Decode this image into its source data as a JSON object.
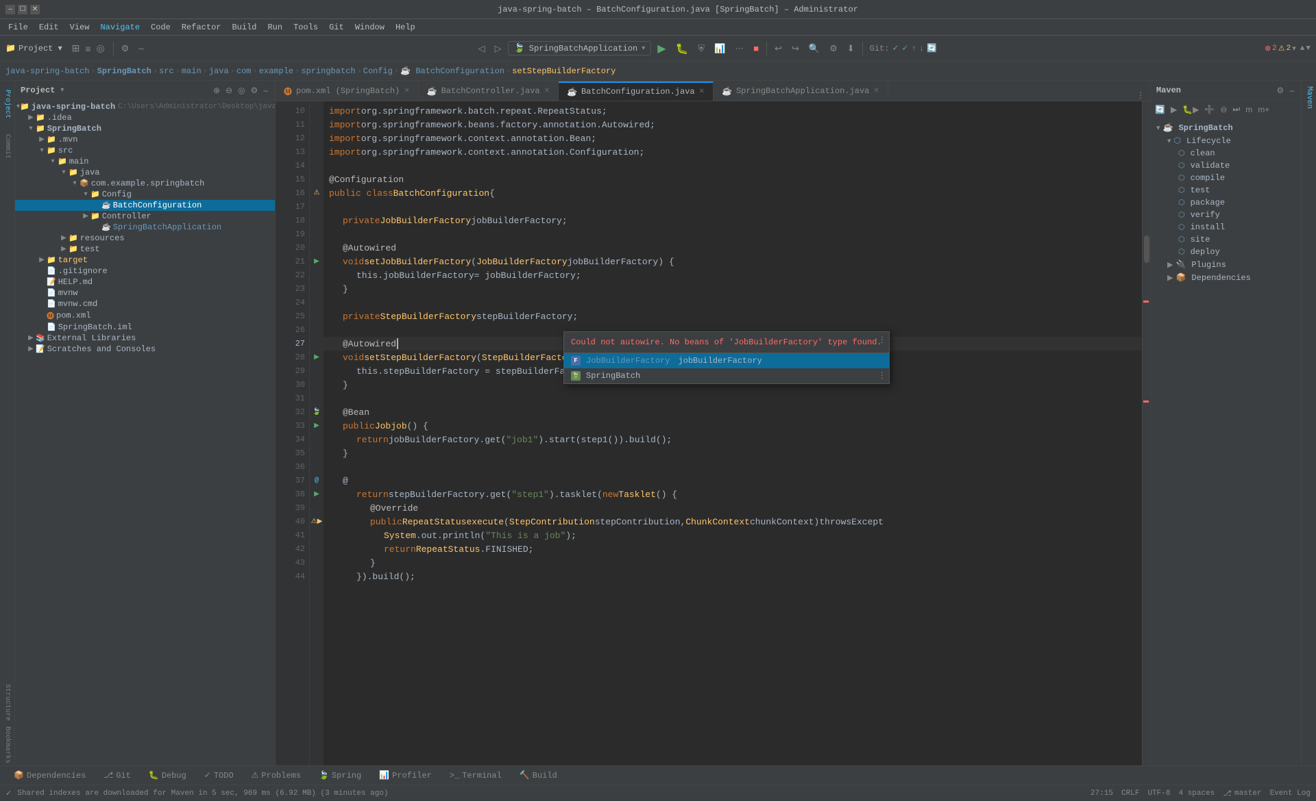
{
  "titleBar": {
    "title": "java-spring-batch – BatchConfiguration.java [SpringBatch] – Administrator",
    "minimize": "–",
    "maximize": "☐",
    "close": "✕"
  },
  "menuBar": {
    "items": [
      "File",
      "Edit",
      "View",
      "Navigate",
      "Code",
      "Refactor",
      "Build",
      "Run",
      "Tools",
      "Git",
      "Window",
      "Help"
    ]
  },
  "navBar": {
    "breadcrumbs": [
      "java-spring-batch",
      "SpringBatch",
      "src",
      "main",
      "java",
      "com",
      "example",
      "springbatch",
      "Config",
      "BatchConfiguration",
      "setStepBuilderFactory"
    ]
  },
  "toolbar": {
    "projectLabel": "Project",
    "runConfig": "SpringBatchApplication",
    "gitBranch": "Git:",
    "masterBranch": "master"
  },
  "tabs": {
    "items": [
      {
        "name": "pom.xml",
        "module": "SpringBatch",
        "active": false,
        "icon": "📄"
      },
      {
        "name": "BatchController.java",
        "active": false,
        "icon": "☕"
      },
      {
        "name": "BatchConfiguration.java",
        "active": true,
        "icon": "☕"
      },
      {
        "name": "SpringBatchApplication.java",
        "active": false,
        "icon": "☕"
      }
    ]
  },
  "fileTree": {
    "rootLabel": "java-spring-batch",
    "rootPath": "C:\\Users\\Administrator\\Desktop\\java-spring",
    "items": [
      {
        "label": "idea",
        "indent": 1,
        "type": "folder",
        "expanded": false
      },
      {
        "label": "SpringBatch",
        "indent": 1,
        "type": "folder",
        "expanded": true,
        "bold": true
      },
      {
        "label": ".mvn",
        "indent": 2,
        "type": "folder",
        "expanded": false
      },
      {
        "label": "src",
        "indent": 2,
        "type": "folder",
        "expanded": true
      },
      {
        "label": "main",
        "indent": 3,
        "type": "folder",
        "expanded": true
      },
      {
        "label": "java",
        "indent": 4,
        "type": "folder",
        "expanded": true
      },
      {
        "label": "com.example.springbatch",
        "indent": 5,
        "type": "package",
        "expanded": true
      },
      {
        "label": "Config",
        "indent": 6,
        "type": "folder",
        "expanded": true
      },
      {
        "label": "BatchConfiguration",
        "indent": 7,
        "type": "java",
        "selected": true
      },
      {
        "label": "Controller",
        "indent": 6,
        "type": "folder",
        "expanded": true
      },
      {
        "label": "SpringBatchApplication",
        "indent": 7,
        "type": "java-spring"
      },
      {
        "label": "resources",
        "indent": 4,
        "type": "folder",
        "expanded": false
      },
      {
        "label": "test",
        "indent": 4,
        "type": "folder",
        "expanded": false
      },
      {
        "label": "target",
        "indent": 2,
        "type": "folder",
        "expanded": false,
        "color": "orange"
      },
      {
        "label": ".gitignore",
        "indent": 2,
        "type": "file"
      },
      {
        "label": "HELP.md",
        "indent": 2,
        "type": "md"
      },
      {
        "label": "mvnw",
        "indent": 2,
        "type": "file"
      },
      {
        "label": "mvnw.cmd",
        "indent": 2,
        "type": "file"
      },
      {
        "label": "pom.xml",
        "indent": 2,
        "type": "xml"
      },
      {
        "label": "SpringBatch.iml",
        "indent": 2,
        "type": "iml"
      },
      {
        "label": "External Libraries",
        "indent": 1,
        "type": "libs",
        "expanded": false
      },
      {
        "label": "Scratches and Consoles",
        "indent": 1,
        "type": "scratches",
        "expanded": false
      }
    ]
  },
  "codeLines": [
    {
      "num": 10,
      "content": "import org.springframework.batch.repeat.RepeatStatus;",
      "gutter": ""
    },
    {
      "num": 11,
      "content": "import org.springframework.beans.factory.annotation.Autowired;",
      "gutter": ""
    },
    {
      "num": 12,
      "content": "import org.springframework.context.annotation.Bean;",
      "gutter": ""
    },
    {
      "num": 13,
      "content": "import org.springframework.context.annotation.Configuration;",
      "gutter": ""
    },
    {
      "num": 14,
      "content": "",
      "gutter": ""
    },
    {
      "num": 15,
      "content": "@Configuration",
      "gutter": ""
    },
    {
      "num": 16,
      "content": "public class BatchConfiguration {",
      "gutter": "warning"
    },
    {
      "num": 17,
      "content": "",
      "gutter": ""
    },
    {
      "num": 18,
      "content": "    private JobBuilderFactory jobBuilderFactory;",
      "gutter": ""
    },
    {
      "num": 19,
      "content": "",
      "gutter": ""
    },
    {
      "num": 20,
      "content": "    @Autowired",
      "gutter": ""
    },
    {
      "num": 21,
      "content": "    void setJobBuilderFactory (JobBuilderFactory jobBuilderFactory) {",
      "gutter": "method"
    },
    {
      "num": 22,
      "content": "        this.jobBuilderFactory = jobBuilderFactory;",
      "gutter": ""
    },
    {
      "num": 23,
      "content": "    }",
      "gutter": ""
    },
    {
      "num": 24,
      "content": "",
      "gutter": ""
    },
    {
      "num": 25,
      "content": "    private StepBuilderFactory stepBuilderFactory;",
      "gutter": ""
    },
    {
      "num": 26,
      "content": "",
      "gutter": ""
    },
    {
      "num": 27,
      "content": "    @Autowired",
      "gutter": ""
    },
    {
      "num": 28,
      "content": "    void setStepBuilderFactory (StepBuilderFactory stepBuilderFactory) {",
      "gutter": "method"
    },
    {
      "num": 29,
      "content": "        this.stepBuilderFactory = stepBuilderFactory;",
      "gutter": ""
    },
    {
      "num": 30,
      "content": "    }",
      "gutter": ""
    },
    {
      "num": 31,
      "content": "",
      "gutter": ""
    },
    {
      "num": 32,
      "content": "    @Bean",
      "gutter": "bean"
    },
    {
      "num": 33,
      "content": "    public Job job () {",
      "gutter": "method"
    },
    {
      "num": 34,
      "content": "        return jobBuilderFactory.get(\"job1\").start(step1()).build();",
      "gutter": ""
    },
    {
      "num": 35,
      "content": "    }",
      "gutter": ""
    },
    {
      "num": 36,
      "content": "",
      "gutter": ""
    },
    {
      "num": 37,
      "content": "    @",
      "gutter": "ann"
    },
    {
      "num": 38,
      "content": "        return stepBuilderFactory.get(\"step1\").tasklet(new Tasklet() {",
      "gutter": "method"
    },
    {
      "num": 39,
      "content": "            @Override",
      "gutter": ""
    },
    {
      "num": 40,
      "content": "            public RepeatStatus execute(StepContribution stepContribution, ChunkContext chunkContext) throws Except",
      "gutter": "warning-method"
    },
    {
      "num": 41,
      "content": "                System.out.println(\"This is a job\");",
      "gutter": ""
    },
    {
      "num": 42,
      "content": "                return RepeatStatus.FINISHED;",
      "gutter": ""
    },
    {
      "num": 43,
      "content": "            }",
      "gutter": ""
    },
    {
      "num": 44,
      "content": "        }).build();",
      "gutter": ""
    }
  ],
  "autocomplete": {
    "warning": "Could not autowire. No beans of 'JobBuilderFactory' type found.",
    "item1_type": "JobBuilderFactory",
    "item1_name": "jobBuilderFactory",
    "item2_name": "SpringBatch",
    "moreBtn": "⋮"
  },
  "maven": {
    "title": "Maven",
    "tree": {
      "springBatch": "SpringBatch",
      "lifecycle": "Lifecycle",
      "lifecycleItems": [
        "clean",
        "validate",
        "compile",
        "test",
        "package",
        "verify",
        "install",
        "site",
        "deploy"
      ],
      "plugins": "Plugins",
      "dependencies": "Dependencies"
    }
  },
  "bottomTabs": {
    "items": [
      {
        "label": "Dependencies",
        "icon": "📦",
        "active": false
      },
      {
        "label": "Git",
        "icon": "⎇",
        "active": false
      },
      {
        "label": "Debug",
        "icon": "🐛",
        "active": false
      },
      {
        "label": "TODO",
        "icon": "✓",
        "active": false
      },
      {
        "label": "Problems",
        "icon": "⚠",
        "active": false
      },
      {
        "label": "Spring",
        "icon": "🍃",
        "active": false
      },
      {
        "label": "Profiler",
        "icon": "📊",
        "active": false
      },
      {
        "label": "Terminal",
        "icon": ">_",
        "active": false
      },
      {
        "label": "Build",
        "icon": "🔨",
        "active": false
      }
    ]
  },
  "statusBar": {
    "message": "Shared indexes are downloaded for Maven in 5 sec, 969 ms (6.92 MB) (3 minutes ago)",
    "position": "27:15",
    "lineEnding": "CRLF",
    "encoding": "UTF-8",
    "indent": "4 spaces",
    "branch": "master",
    "eventLog": "Event Log",
    "errors": "2",
    "warnings": "2"
  },
  "rightSidebarTabs": [
    "Maven"
  ]
}
